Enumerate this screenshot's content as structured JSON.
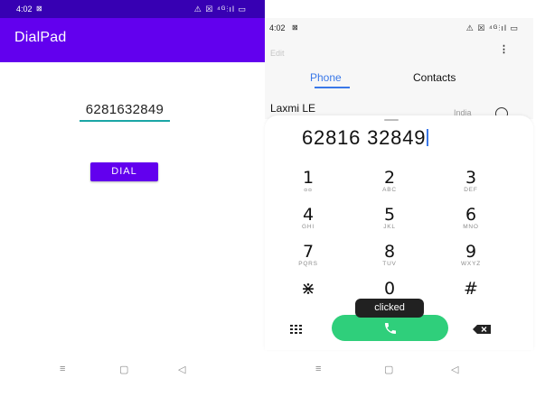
{
  "left": {
    "status": {
      "time": "4:02",
      "notif_glyph": "⊠",
      "icons": "⚠ ☒ ⁴ᴳ⫶ıl ▭"
    },
    "app_title": "DialPad",
    "number_value": "6281632849",
    "dial_label": "DIAL",
    "navbar": {
      "menu": "≡",
      "home": "▢",
      "back": "◁"
    }
  },
  "right": {
    "status": {
      "time": "4:02",
      "notif_glyph": "⊠",
      "icons": "⚠ ☒ ⁴ᴳ⫶ıl ▭"
    },
    "edit_label": "Edit",
    "more_glyph": "⋮",
    "tabs": [
      {
        "label": "Phone",
        "active": true
      },
      {
        "label": "Contacts",
        "active": false
      }
    ],
    "contact": {
      "name": "Laxmi LE",
      "sub": "India"
    },
    "dialed_number": "62816 32849",
    "keys": [
      {
        "digit": "1",
        "letters": "ᴑᴑ"
      },
      {
        "digit": "2",
        "letters": "ABC"
      },
      {
        "digit": "3",
        "letters": "DEF"
      },
      {
        "digit": "4",
        "letters": "GHI"
      },
      {
        "digit": "5",
        "letters": "JKL"
      },
      {
        "digit": "6",
        "letters": "MNO"
      },
      {
        "digit": "7",
        "letters": "PQRS"
      },
      {
        "digit": "8",
        "letters": "TUV"
      },
      {
        "digit": "9",
        "letters": "WXYZ"
      },
      {
        "digit": "⋇",
        "letters": ""
      },
      {
        "digit": "0",
        "letters": ""
      },
      {
        "digit": "#",
        "letters": ""
      }
    ],
    "toast": "clicked",
    "icons": {
      "pad": "dialpad-icon",
      "call": "phone-icon",
      "backspace": "backspace-icon"
    },
    "colors": {
      "accent": "#3a78e8",
      "call": "#2fcf7b",
      "toast_bg": "#212121"
    },
    "navbar": {
      "menu": "≡",
      "home": "▢",
      "back": "◁"
    }
  },
  "colors": {
    "status_bar": "#3700b3",
    "app_bar": "#6200ee",
    "dial_button": "#6200ee",
    "field_underline": "#1aa6a6"
  }
}
